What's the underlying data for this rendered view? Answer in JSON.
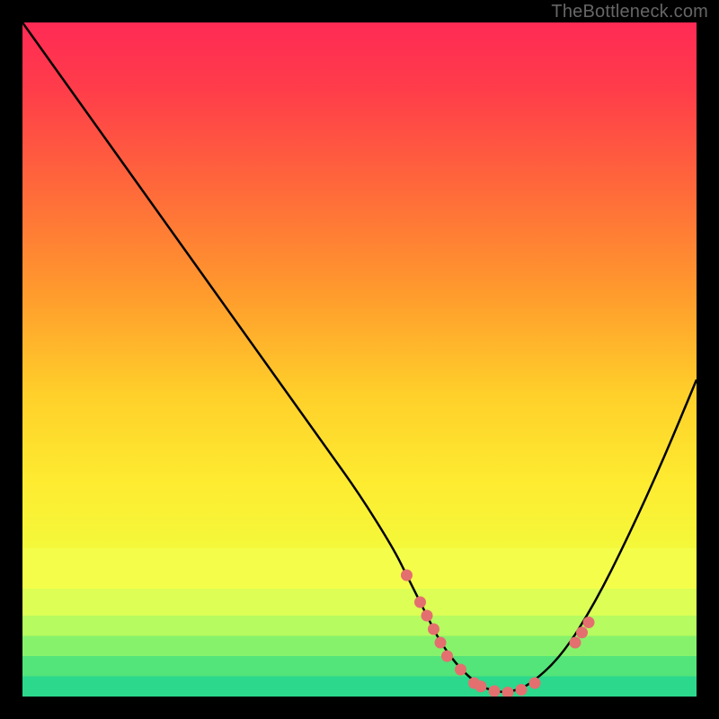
{
  "watermark": "TheBottleneck.com",
  "chart_data": {
    "type": "line",
    "title": "",
    "xlabel": "",
    "ylabel": "",
    "xlim": [
      0,
      100
    ],
    "ylim": [
      0,
      100
    ],
    "x": [
      0,
      5,
      10,
      15,
      20,
      25,
      30,
      35,
      40,
      45,
      50,
      55,
      57,
      60,
      62,
      65,
      68,
      70,
      72,
      75,
      80,
      85,
      90,
      95,
      100
    ],
    "curve_y": [
      100,
      93,
      86,
      79,
      72,
      65,
      58,
      51,
      44,
      37,
      30,
      22,
      18,
      12,
      8,
      4,
      1.5,
      0.8,
      0.6,
      1.5,
      6,
      14,
      24,
      35,
      47
    ],
    "markers": {
      "x": [
        57,
        59,
        60,
        61,
        62,
        63,
        65,
        67,
        68,
        70,
        72,
        74,
        76,
        82,
        83,
        84
      ],
      "y": [
        18,
        14,
        12,
        10,
        8,
        6,
        4,
        2,
        1.5,
        0.8,
        0.6,
        1,
        2,
        8,
        9.5,
        11
      ]
    },
    "gradient_stops": [
      {
        "offset": 0.0,
        "color": "#ff2a55"
      },
      {
        "offset": 0.1,
        "color": "#ff3d4a"
      },
      {
        "offset": 0.25,
        "color": "#ff6a3a"
      },
      {
        "offset": 0.4,
        "color": "#ff9a2d"
      },
      {
        "offset": 0.55,
        "color": "#ffcf2a"
      },
      {
        "offset": 0.68,
        "color": "#feeb30"
      },
      {
        "offset": 0.78,
        "color": "#f4f83a"
      },
      {
        "offset": 0.86,
        "color": "#e3ff55"
      },
      {
        "offset": 0.92,
        "color": "#b8ff70"
      },
      {
        "offset": 0.96,
        "color": "#7dff8a"
      },
      {
        "offset": 1.0,
        "color": "#2eff9a"
      }
    ],
    "bottom_bands": [
      {
        "from_y": 0,
        "to_y": 3,
        "color": "#2bd88c"
      },
      {
        "from_y": 3,
        "to_y": 6,
        "color": "#53e47a"
      },
      {
        "from_y": 6,
        "to_y": 9,
        "color": "#86f26b"
      },
      {
        "from_y": 9,
        "to_y": 12,
        "color": "#b6fb5f"
      },
      {
        "from_y": 12,
        "to_y": 16,
        "color": "#dcfe55"
      },
      {
        "from_y": 16,
        "to_y": 22,
        "color": "#f4fe4a"
      }
    ],
    "marker_color": "#e46f6f",
    "curve_color": "#000000"
  }
}
